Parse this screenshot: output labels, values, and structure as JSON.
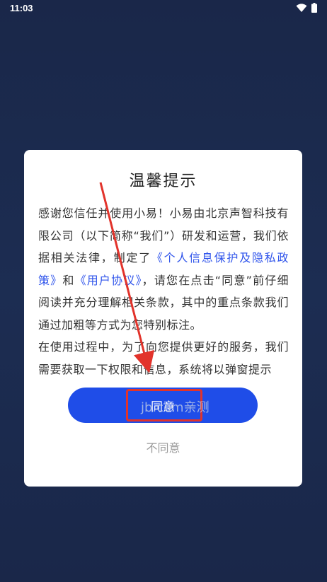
{
  "status_bar": {
    "time": "11:03",
    "icons": [
      "wifi-icon",
      "battery-icon"
    ]
  },
  "dialog": {
    "title": "温馨提示",
    "body": {
      "intro": "感谢您信任并使用小易！小易由北京声智科技有限公司（以下简称“我们”）研发和运营，我们依据相关法律，制定了",
      "privacy_link": "《个人信息保护及隐私政策》",
      "and": "和",
      "user_link": "《用户协议》",
      "after_links": "，请您在点击“同意”前仔细阅读并充分理解相关条款，其中的重点条款我们通过加粗等方式为您特别标注。",
      "second_paragraph": "在使用过程中，为了向您提供更好的服务，我们需要获取一下权限和信息，系统将以弹窗提示"
    },
    "agree_label": "同意",
    "disagree_label": "不同意"
  },
  "watermark": "jb.com亲测",
  "colors": {
    "background": "#1b2a4e",
    "accent": "#1f4de8",
    "link": "#2f54eb",
    "annotation": "#e2332b"
  }
}
